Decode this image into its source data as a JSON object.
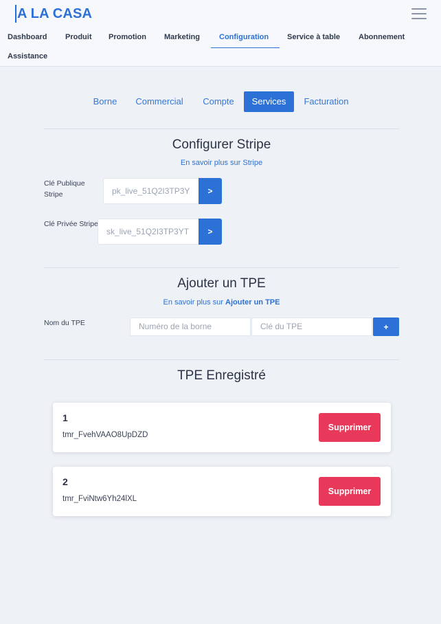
{
  "app": {
    "logo": "A LA CASA",
    "menu_icon": "hamburger-menu-icon"
  },
  "nav": {
    "items": [
      {
        "label": "Dashboard"
      },
      {
        "label": "Produit"
      },
      {
        "label": "Promotion"
      },
      {
        "label": "Marketing"
      },
      {
        "label": "Configuration",
        "active": true
      },
      {
        "label": "Service à table"
      },
      {
        "label": "Abonnement"
      },
      {
        "label": "Assistance"
      }
    ]
  },
  "tabs": [
    {
      "label": "Borne"
    },
    {
      "label": "Commercial"
    },
    {
      "label": "Compte"
    },
    {
      "label": "Services",
      "active": true
    },
    {
      "label": "Facturation"
    }
  ],
  "stripe": {
    "title": "Configurer Stripe",
    "link": "En savoir plus sur Stripe",
    "public_label": "Clé Publique Stripe",
    "public_value": "pk_live_51Q2I3TP3Y",
    "private_label": "Clé Privée Stripe",
    "private_value": "sk_live_51Q2I3TP3YT",
    "submit_glyph": ">"
  },
  "tpe": {
    "title": "Ajouter un TPE",
    "link_prefix": "En savoir plus sur",
    "link_bold": "Ajouter un TPE",
    "name_label": "Nom du TPE",
    "borne_placeholder": "Numéro de la borne",
    "key_placeholder": "Clé du TPE",
    "add_glyph": "+"
  },
  "registered": {
    "title": "TPE Enregistré",
    "delete_label": "Supprimer",
    "items": [
      {
        "number": "1",
        "id": "tmr_FvehVAAO8UpDZD"
      },
      {
        "number": "2",
        "id": "tmr_FviNtw6Yh24lXL"
      }
    ]
  },
  "colors": {
    "accent": "#2b71d6",
    "danger": "#e8395a",
    "background": "#eef1f6"
  }
}
